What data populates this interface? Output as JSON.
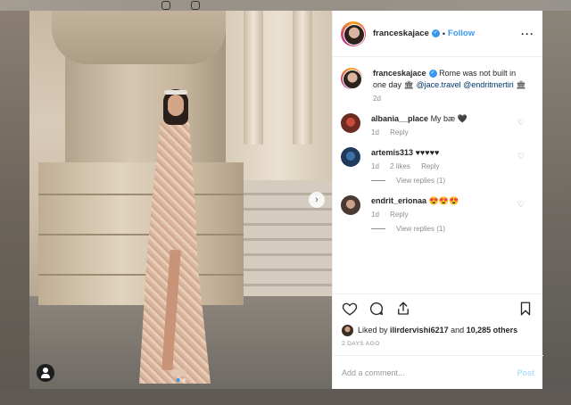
{
  "post": {
    "username": "franceskajace",
    "follow_label": "Follow",
    "more_label": "···",
    "next_label": "›"
  },
  "comments": [
    {
      "username": "franceskajace",
      "text": "Rome was not built in one day 🏛 ",
      "mention1": "@jace.travel",
      "mention2": "@endritmertiri",
      "trail": " 🏛",
      "age": "2d"
    },
    {
      "username": "albania__place",
      "text": "My bæ 🖤",
      "age": "1d",
      "reply": "Reply"
    },
    {
      "username": "artemis313",
      "text": "♥♥♥♥♥",
      "age": "1d",
      "likes": "2 likes",
      "reply": "Reply",
      "view_replies": "View replies (1)"
    },
    {
      "username": "endrit_erionaa",
      "text": "😍😍😍",
      "age": "1d",
      "reply": "Reply",
      "view_replies": "View replies (1)"
    }
  ],
  "likes": {
    "prefix": "Liked by",
    "user": "ilirdervishi6217",
    "middle": "and",
    "count": "10,285 others"
  },
  "timestamp": "2 DAYS AGO",
  "add_comment": {
    "placeholder": "Add a comment...",
    "post_label": "Post"
  },
  "colors": {
    "link_blue": "#3897f0",
    "post_disabled": "#b2dffc",
    "text": "#262626",
    "meta": "#8e8e8e"
  },
  "icons": [
    "heart-icon",
    "comment-icon",
    "share-icon",
    "bookmark-icon",
    "tag-user-icon",
    "verified-icon",
    "chevron-right-icon"
  ]
}
